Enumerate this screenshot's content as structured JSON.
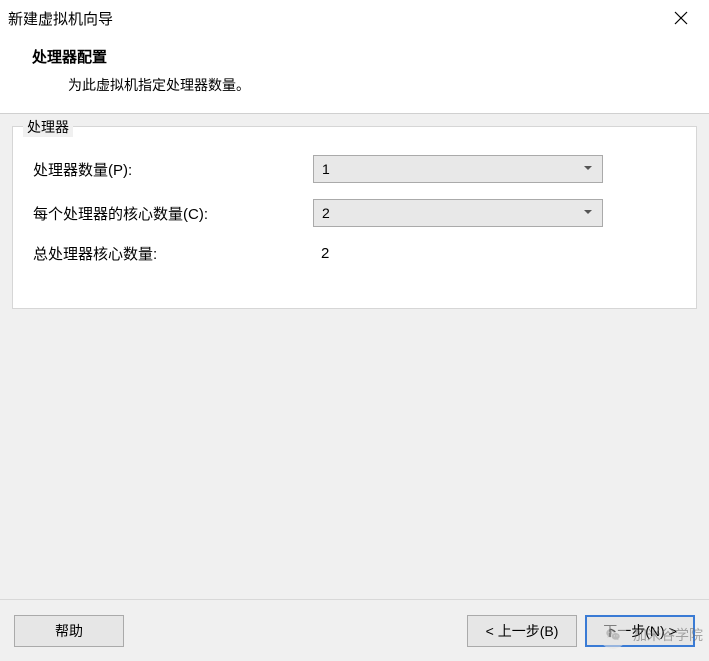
{
  "window": {
    "title": "新建虚拟机向导"
  },
  "header": {
    "title": "处理器配置",
    "subtitle": "为此虚拟机指定处理器数量。"
  },
  "group": {
    "legend": "处理器",
    "rows": {
      "proc_count": {
        "label": "处理器数量(P):",
        "value": "1"
      },
      "cores_per": {
        "label": "每个处理器的核心数量(C):",
        "value": "2"
      },
      "total": {
        "label": "总处理器核心数量:",
        "value": "2"
      }
    }
  },
  "footer": {
    "help": "帮助",
    "back": "< 上一步(B)",
    "next": "下一步(N) >"
  },
  "watermark": {
    "text": "加米谷学院"
  }
}
